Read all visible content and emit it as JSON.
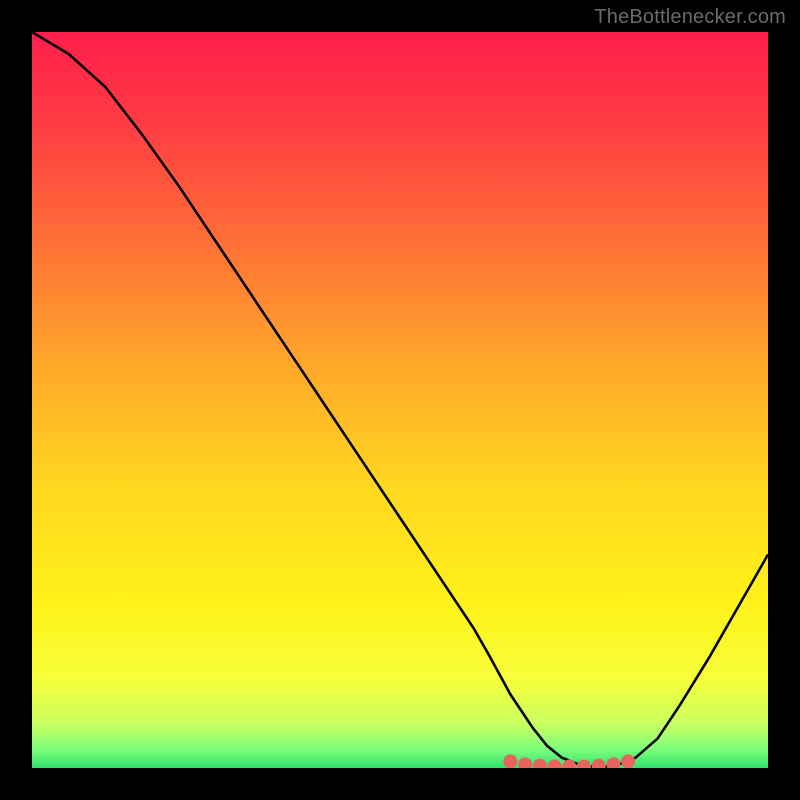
{
  "watermark": {
    "text": "TheBottlenecker.com"
  },
  "chart_data": {
    "type": "line",
    "title": "",
    "xlabel": "",
    "ylabel": "",
    "xlim": [
      0,
      100
    ],
    "ylim": [
      0,
      100
    ],
    "background_gradient": {
      "stops": [
        {
          "offset": 0.0,
          "color": "#ff1f4b"
        },
        {
          "offset": 0.12,
          "color": "#ff3a43"
        },
        {
          "offset": 0.28,
          "color": "#ff6e37"
        },
        {
          "offset": 0.45,
          "color": "#ffa72a"
        },
        {
          "offset": 0.62,
          "color": "#ffd81f"
        },
        {
          "offset": 0.78,
          "color": "#fff21a"
        },
        {
          "offset": 0.88,
          "color": "#f6ff3a"
        },
        {
          "offset": 0.94,
          "color": "#c8ff60"
        },
        {
          "offset": 0.975,
          "color": "#7cff7a"
        },
        {
          "offset": 1.0,
          "color": "#30e070"
        }
      ]
    },
    "series": [
      {
        "name": "bottleneck-curve",
        "type": "line",
        "color": "#000000",
        "x": [
          0,
          5,
          10,
          15,
          20,
          25,
          30,
          35,
          40,
          45,
          50,
          55,
          60,
          62,
          65,
          68,
          70,
          72,
          74,
          76,
          78,
          80,
          82,
          85,
          88,
          92,
          96,
          100
        ],
        "y": [
          100,
          97,
          92.5,
          86,
          79,
          71.5,
          64,
          56.5,
          49,
          41.5,
          34,
          26.5,
          19,
          15.5,
          10,
          5.5,
          3.0,
          1.4,
          0.6,
          0.2,
          0.2,
          0.6,
          1.4,
          4.0,
          8.5,
          15,
          22,
          29
        ]
      },
      {
        "name": "bottom-markers",
        "type": "scatter",
        "color": "#e9645f",
        "x": [
          65,
          67,
          69,
          71,
          73,
          75,
          77,
          79,
          81
        ],
        "y": [
          0.9,
          0.5,
          0.3,
          0.2,
          0.2,
          0.2,
          0.3,
          0.5,
          0.9
        ]
      }
    ]
  }
}
